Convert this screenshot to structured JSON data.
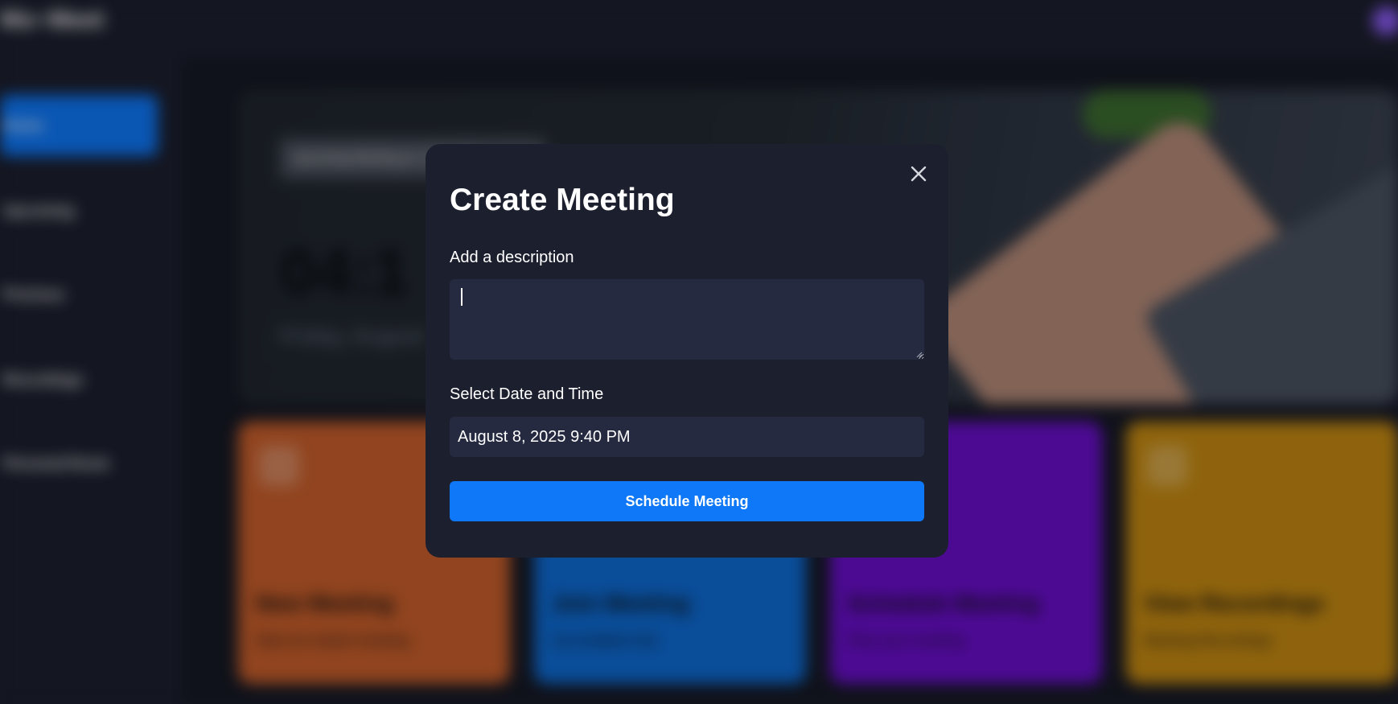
{
  "background": {
    "logo_text": "Mo~Meet",
    "sidebar": {
      "items": [
        {
          "label": "Home",
          "active": true
        },
        {
          "label": "Upcoming",
          "active": false
        },
        {
          "label": "Previous",
          "active": false
        },
        {
          "label": "Recordings",
          "active": false
        },
        {
          "label": "Personal Room",
          "active": false
        }
      ]
    },
    "hero": {
      "pill_text": "Upcoming Meeting at: 12:30 PM",
      "time": "04:1",
      "date": "Friday, August"
    },
    "cards": [
      {
        "title": "New Meeting",
        "subtitle": "Start an instant meeting",
        "color": "#c95f2b"
      },
      {
        "title": "Join Meeting",
        "subtitle": "via invitation link",
        "color": "#0e6bd4"
      },
      {
        "title": "Schedule Meeting",
        "subtitle": "Plan your meeting",
        "color": "#6a0fcc"
      },
      {
        "title": "View Recordings",
        "subtitle": "Meeting Recordings",
        "color": "#c68a12"
      }
    ]
  },
  "modal": {
    "title": "Create Meeting",
    "description_label": "Add a description",
    "description_value": "",
    "datetime_label": "Select Date and Time",
    "datetime_value": "August 8, 2025 9:40 PM",
    "submit_label": "Schedule Meeting",
    "close_icon": "close-icon"
  },
  "colors": {
    "accent": "#0e78f9",
    "modal_bg": "#1c1f2e",
    "input_bg": "#252a41"
  }
}
